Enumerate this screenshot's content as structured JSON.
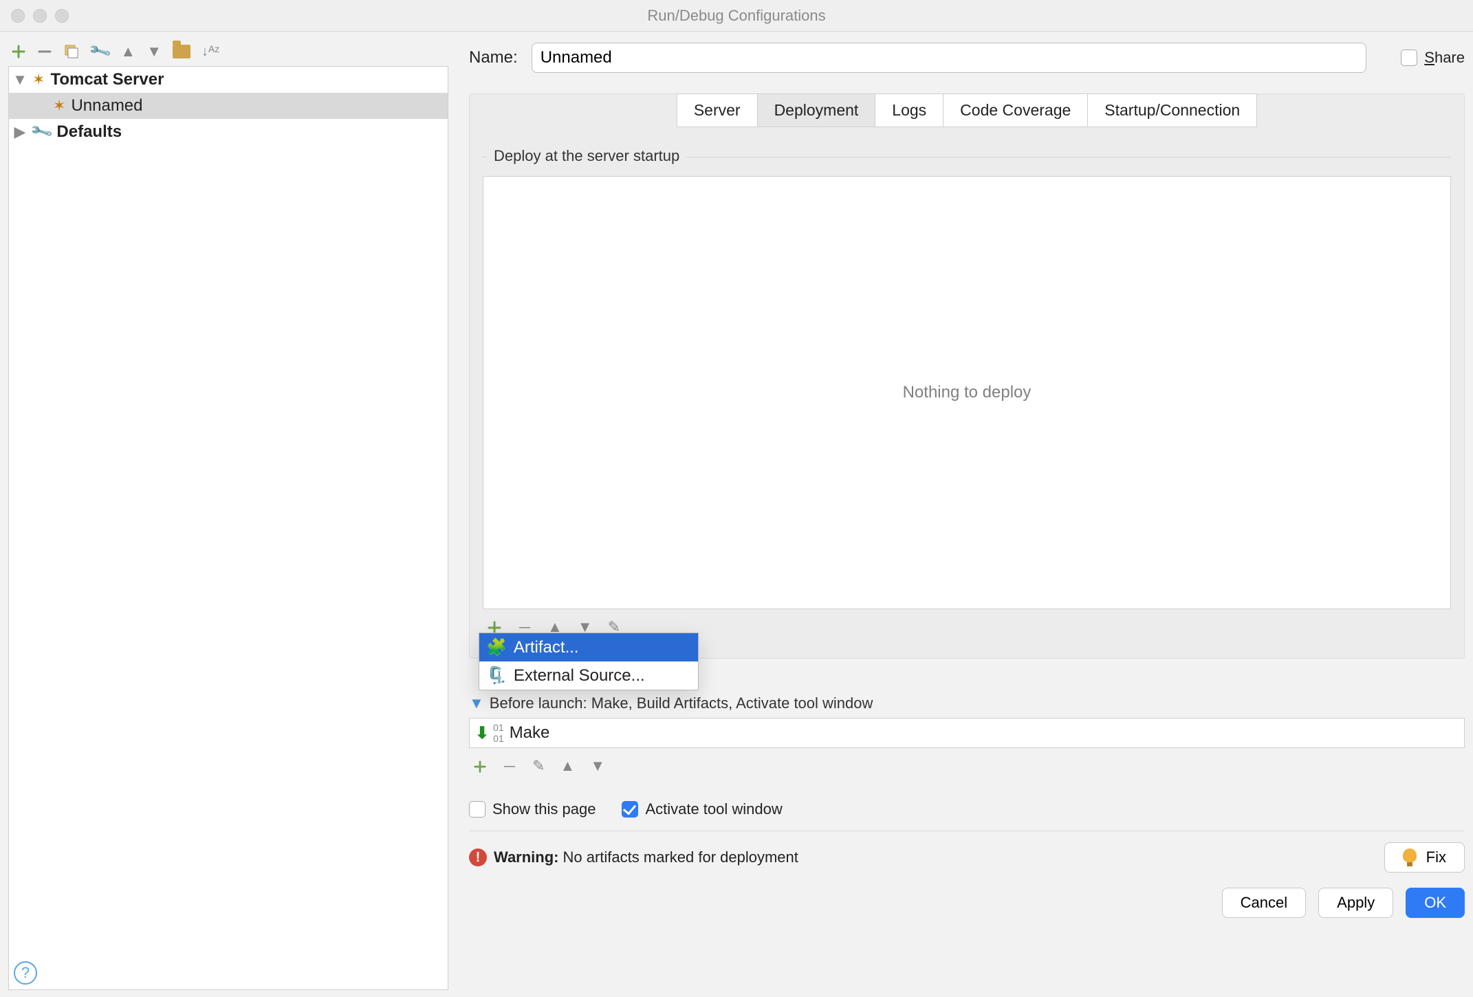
{
  "window": {
    "title": "Run/Debug Configurations"
  },
  "name": {
    "label": "Name:",
    "value": "Unnamed"
  },
  "share_label": "Share",
  "tree": {
    "items": [
      {
        "label": "Tomcat Server",
        "bold": true,
        "expandable": true
      },
      {
        "label": "Unnamed",
        "selected": true
      },
      {
        "label": "Defaults",
        "bold": true,
        "expandable": true
      }
    ]
  },
  "tabs": [
    "Server",
    "Deployment",
    "Logs",
    "Code Coverage",
    "Startup/Connection"
  ],
  "selected_tab": "Deployment",
  "deploy": {
    "group_title": "Deploy at the server startup",
    "placeholder": "Nothing to deploy"
  },
  "add_menu": [
    "Artifact...",
    "External Source..."
  ],
  "before_launch": {
    "header": "Before launch: Make, Build Artifacts, Activate tool window",
    "item": "Make"
  },
  "checks": {
    "show_this_page": "Show this page",
    "activate": "Activate tool window"
  },
  "warning": {
    "label": "Warning:",
    "text": "No artifacts marked for deployment"
  },
  "buttons": {
    "fix": "Fix",
    "cancel": "Cancel",
    "apply": "Apply",
    "ok": "OK"
  }
}
